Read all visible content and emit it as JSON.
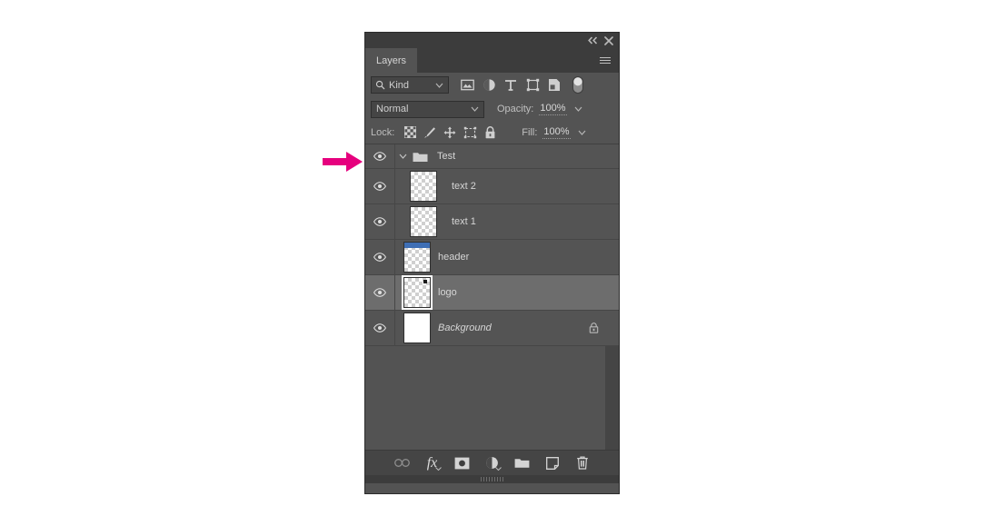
{
  "app": {
    "panel_title": "Layers",
    "accent_color": "#e6007e",
    "panel_bg": "#535353",
    "row_bg": "#545454",
    "row_selected_bg": "#6d6d6d",
    "thumb_header_bar_color": "#3f6fb5"
  },
  "titlebar": {
    "collapse_icon": "double-chevron-left-icon",
    "close_icon": "close-icon"
  },
  "tabbar": {
    "tabs": [
      {
        "label": "Layers",
        "active": true
      }
    ],
    "menu_icon": "panel-menu-icon"
  },
  "filter_row": {
    "kind_label": "Kind",
    "search_icon": "search-icon",
    "caret_icon": "chevron-down-icon",
    "filters": [
      {
        "name": "filter-pixel-layers",
        "icon": "image-icon"
      },
      {
        "name": "filter-adjustment-layers",
        "icon": "adjustment-icon"
      },
      {
        "name": "filter-type-layers",
        "icon": "type-icon"
      },
      {
        "name": "filter-shape-layers",
        "icon": "shape-icon"
      },
      {
        "name": "filter-smart-objects",
        "icon": "smart-object-icon"
      }
    ],
    "toggle_name": "filter-enable-toggle"
  },
  "blend_row": {
    "blend_mode": "Normal",
    "opacity_label": "Opacity:",
    "opacity_value": "100%"
  },
  "lock_row": {
    "lock_label": "Lock:",
    "locks": [
      {
        "name": "lock-transparent-pixels",
        "icon": "checkerboard-icon"
      },
      {
        "name": "lock-image-pixels",
        "icon": "brush-icon"
      },
      {
        "name": "lock-position",
        "icon": "move-icon"
      },
      {
        "name": "lock-artboard-nesting",
        "icon": "artboard-icon"
      },
      {
        "name": "lock-all",
        "icon": "lock-icon"
      }
    ],
    "fill_label": "Fill:",
    "fill_value": "100%"
  },
  "layers": [
    {
      "name": "Test",
      "type": "group",
      "visible": true,
      "selected": false,
      "expanded": true,
      "locked": false,
      "thumb": "none"
    },
    {
      "name": "text 2",
      "type": "layer",
      "visible": true,
      "selected": false,
      "locked": false,
      "thumb": "transparent",
      "indent": true
    },
    {
      "name": "text 1",
      "type": "layer",
      "visible": true,
      "selected": false,
      "locked": false,
      "thumb": "transparent",
      "indent": true
    },
    {
      "name": "header",
      "type": "layer",
      "visible": true,
      "selected": false,
      "locked": false,
      "thumb": "transparent-with-blue-bar",
      "indent": false
    },
    {
      "name": "logo",
      "type": "layer",
      "visible": true,
      "selected": true,
      "locked": false,
      "thumb": "transparent-with-dot",
      "indent": false
    },
    {
      "name": "Background",
      "type": "layer",
      "visible": true,
      "selected": false,
      "locked": true,
      "italic": true,
      "thumb": "white",
      "indent": false
    }
  ],
  "footer": {
    "buttons": [
      {
        "name": "link-layers-button",
        "icon": "link-icon",
        "label": "Link layers"
      },
      {
        "name": "layer-style-button",
        "icon": "fx-icon",
        "label": "fx"
      },
      {
        "name": "add-layer-mask-button",
        "icon": "mask-icon",
        "label": "Add layer mask"
      },
      {
        "name": "new-fill-adjustment-button",
        "icon": "adjustment-icon",
        "label": "New adjustment layer"
      },
      {
        "name": "new-group-button",
        "icon": "folder-icon",
        "label": "New group"
      },
      {
        "name": "new-layer-button",
        "icon": "new-layer-icon",
        "label": "New layer"
      },
      {
        "name": "delete-layer-button",
        "icon": "trash-icon",
        "label": "Delete layer"
      }
    ]
  },
  "annotation": {
    "arrow_icon": "right-arrow-icon",
    "arrow_color": "#e6007e",
    "points_at": "Test"
  }
}
